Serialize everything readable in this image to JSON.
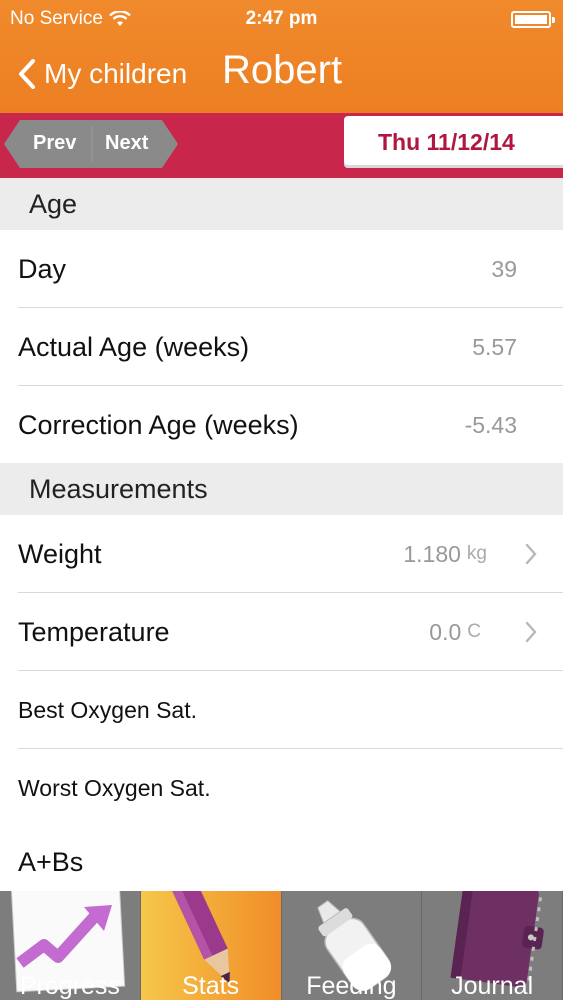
{
  "status": {
    "carrier": "No Service",
    "time": "2:47 pm"
  },
  "nav": {
    "back_label": "My children",
    "title": "Robert"
  },
  "datebar": {
    "prev_label": "Prev",
    "next_label": "Next",
    "date": "Thu 11/12/14"
  },
  "sections": {
    "age": {
      "header": "Age",
      "rows": [
        {
          "label": "Day",
          "value": "39"
        },
        {
          "label": "Actual Age (weeks)",
          "value": "5.57"
        },
        {
          "label": "Correction Age (weeks)",
          "value": "-5.43"
        }
      ]
    },
    "measurements": {
      "header": "Measurements",
      "rows": [
        {
          "label": "Weight",
          "value": "1.180",
          "unit": "kg"
        },
        {
          "label": "Temperature",
          "value": "0.0",
          "unit": "C"
        },
        {
          "label": "Best Oxygen Sat.",
          "value": ""
        },
        {
          "label": "Worst Oxygen Sat.",
          "value": ""
        },
        {
          "label": "A+Bs",
          "value": ""
        }
      ]
    }
  },
  "tabs": [
    {
      "label": "Progress",
      "icon": "progress-chart-icon"
    },
    {
      "label": "Stats",
      "icon": "pencil-icon"
    },
    {
      "label": "Feeding",
      "icon": "feeding-bottle-icon"
    },
    {
      "label": "Journal",
      "icon": "journal-book-icon"
    }
  ],
  "colors": {
    "header": "#ec7f22",
    "datebar": "#c8274b",
    "date_text": "#b0163f",
    "tab_active": "#f6c74a"
  }
}
